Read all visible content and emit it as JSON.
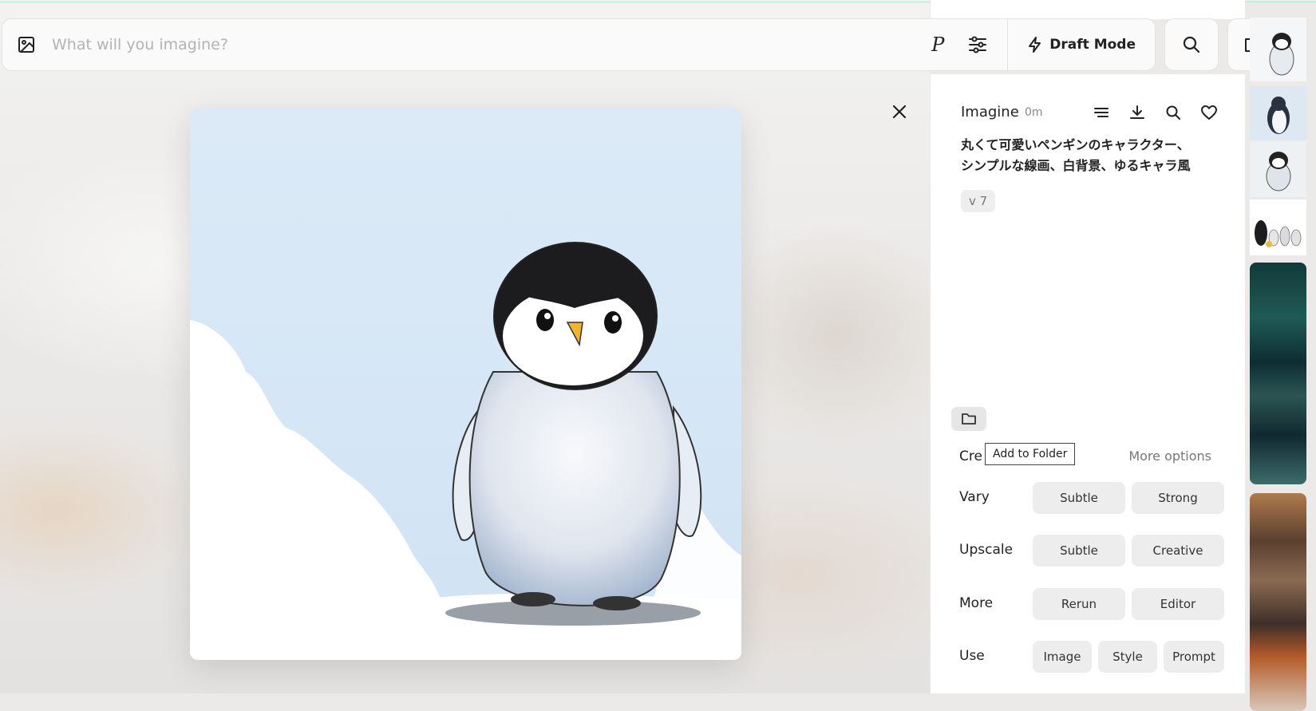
{
  "search": {
    "placeholder": "What will you imagine?",
    "personalize_label": "P",
    "draft_mode_label": "Draft Mode"
  },
  "panel": {
    "title": "Imagine",
    "time": "0m",
    "prompt": "丸くて可愛いペンギンのキャラクター、シンプルな線画、白背景、ゆるキャラ風",
    "version": "v 7",
    "create_label": "Create",
    "tooltip": "Add to Folder",
    "more_options": "More options",
    "rows": [
      {
        "label": "Vary",
        "buttons": [
          "Subtle",
          "Strong"
        ]
      },
      {
        "label": "Upscale",
        "buttons": [
          "Subtle",
          "Creative"
        ]
      },
      {
        "label": "More",
        "buttons": [
          "Rerun",
          "Editor"
        ]
      },
      {
        "label": "Use",
        "buttons": [
          "Image",
          "Style",
          "Prompt"
        ]
      }
    ]
  },
  "colors": {
    "sky": "#d7e7f6",
    "panel_bg": "#ffffff",
    "button_bg": "#ededed",
    "accent_line": "#bde0d6"
  },
  "icons": [
    "image-icon",
    "sliders-icon",
    "lightning-icon",
    "search-icon",
    "folder-icon",
    "close-icon",
    "menu-lines-icon",
    "download-icon",
    "heart-icon"
  ]
}
